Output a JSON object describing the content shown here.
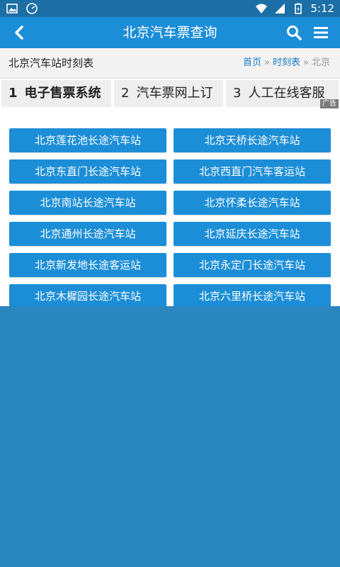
{
  "status_bar": {
    "time": "5:12",
    "icons": [
      "image-icon",
      "speedometer-icon",
      "wifi-icon",
      "signal-icon",
      "battery-icon"
    ]
  },
  "app_bar": {
    "title": "北京汽车票查询",
    "icons": [
      "back-icon",
      "search-icon",
      "menu-icon"
    ]
  },
  "breadcrumb_row": {
    "page_title": "北京汽车站时刻表",
    "crumbs": [
      {
        "label": "首页",
        "link": true
      },
      {
        "label": "»",
        "link": false
      },
      {
        "label": "时刻表",
        "link": true
      },
      {
        "label": "»",
        "link": false
      },
      {
        "label": "北京",
        "link": false
      }
    ]
  },
  "ad_tabs": {
    "tabs": [
      {
        "num": "1",
        "label": "电子售票系统"
      },
      {
        "num": "2",
        "label": "汽车票网上订"
      },
      {
        "num": "3",
        "label": "人工在线客服"
      }
    ],
    "badge": "广告"
  },
  "stations": [
    "北京莲花池长途汽车站",
    "北京天桥长途汽车站",
    "北京东直门长途汽车站",
    "北京西直门汽车客运站",
    "北京南站长途汽车站",
    "北京怀柔长途汽车站",
    "北京通州长途汽车站",
    "北京延庆长途汽车站",
    "北京新发地长途客运站",
    "北京永定门长途汽车站",
    "北京木樨园长途汽车站",
    "北京六里桥长途汽车站"
  ],
  "colors": {
    "status_bar": "#1b6fa6",
    "app_bar": "#1c8ed7",
    "station_button": "#1c8ed7",
    "overlay": "#2a86bf",
    "link": "#1c7cc5"
  }
}
